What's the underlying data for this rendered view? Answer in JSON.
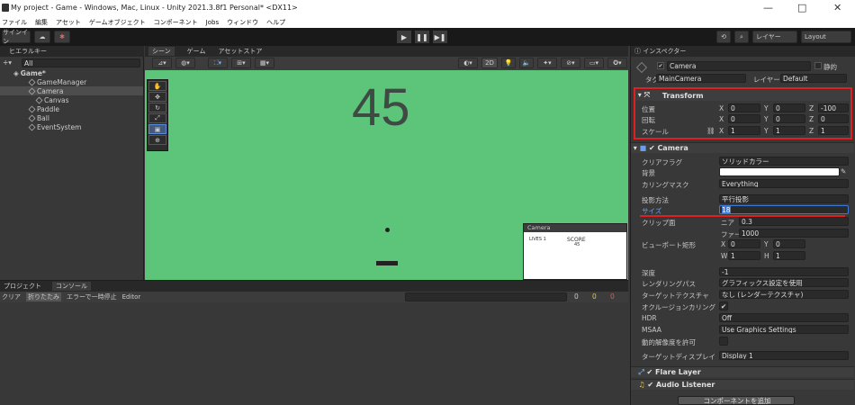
{
  "window": {
    "title": "My project - Game - Windows, Mac, Linux - Unity 2021.3.8f1 Personal* <DX11>",
    "minimize": "—",
    "maximize": "□",
    "close": "✕"
  },
  "menu": [
    "ファイル",
    "編集",
    "アセット",
    "ゲームオブジェクト",
    "コンポーネント",
    "Jobs",
    "ウィンドウ",
    "ヘルプ"
  ],
  "toolbar": {
    "sign_in": "サインイン",
    "layer": "レイヤー",
    "layout": "Layout"
  },
  "hierarchy": {
    "tab": "ヒエラルキー",
    "search": "All",
    "items": [
      "Game*",
      "GameManager",
      "Camera",
      "Canvas",
      "Paddle",
      "Ball",
      "EventSystem"
    ]
  },
  "scene": {
    "tabs": [
      "シーン",
      "ゲーム",
      "アセットストア"
    ],
    "score_big": "45",
    "mode_2d": "2D"
  },
  "camera_preview": {
    "title": "Camera",
    "lives": "LIVES 1",
    "score_label": "SCORE",
    "score_value": "45"
  },
  "console": {
    "tabs": [
      "プロジェクト",
      "コンソール"
    ],
    "buttons": [
      "クリア",
      "折りたたみ",
      "エラーで一時停止",
      "Editor"
    ],
    "counts": [
      "0",
      "0",
      "0"
    ]
  },
  "inspector": {
    "tab": "インスペクター",
    "name": "Camera",
    "static": "静的",
    "tag_label": "タグ",
    "tag": "MainCamera",
    "layer_label": "レイヤー",
    "layer": "Default",
    "transform": {
      "title": "Transform",
      "rows": [
        {
          "label": "位置",
          "x": "0",
          "y": "0",
          "z": "-100"
        },
        {
          "label": "回転",
          "x": "0",
          "y": "0",
          "z": "0"
        },
        {
          "label": "スケール",
          "x": "1",
          "y": "1",
          "z": "1"
        }
      ]
    },
    "camera": {
      "title": "Camera",
      "rows": [
        {
          "label": "クリアフラグ",
          "value": "ソリッドカラー"
        },
        {
          "label": "背景",
          "value": ""
        },
        {
          "label": "カリングマスク",
          "value": "Everything"
        },
        {
          "label": "投影方法",
          "value": "平行投影"
        },
        {
          "label": "サイズ",
          "value": "18"
        }
      ],
      "clip": {
        "label": "クリップ面",
        "near_label": "ニア",
        "near": "0.3",
        "far_label": "ファー",
        "far": "1000"
      },
      "viewport": {
        "label": "ビューポート矩形",
        "x": "0",
        "y": "0",
        "w": "1",
        "h": "1"
      },
      "rows2": [
        {
          "label": "深度",
          "value": "-1"
        },
        {
          "label": "レンダリングパス",
          "value": "グラフィックス設定を使用"
        },
        {
          "label": "ターゲットテクスチャ",
          "value": "なし (レンダーテクスチャ)"
        },
        {
          "label": "オクルージョンカリング",
          "value": "✔"
        },
        {
          "label": "HDR",
          "value": "Off"
        },
        {
          "label": "MSAA",
          "value": "Use Graphics Settings"
        },
        {
          "label": "動的解像度を許可",
          "value": ""
        },
        {
          "label": "ターゲットディスプレイ",
          "value": "Display 1"
        }
      ]
    },
    "flare": "Flare Layer",
    "audio": "Audio Listener",
    "add_component": "コンポーネントを追加"
  },
  "colors": {
    "scene_bg": "#5cc57a",
    "highlight": "#e02020",
    "accent": "#3d7ad8"
  }
}
